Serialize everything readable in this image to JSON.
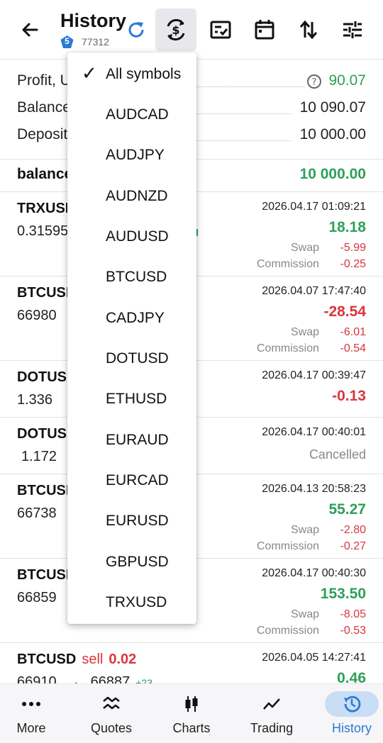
{
  "header": {
    "title": "History",
    "account_badge": "5",
    "account_number": "77312"
  },
  "summary": {
    "profit_label": "Profit, U",
    "profit_value": "90.07",
    "balance_label": "Balance",
    "balance_value": "10 090.07",
    "deposit_label": "Deposit",
    "deposit_value": "10 000.00",
    "balance_row_label": "balance",
    "balance_row_value": "10 000.00"
  },
  "trades": [
    {
      "symbol": "TRXUSI",
      "price": "0.31595",
      "date": "2026.04.17 01:09:21",
      "profit": "18.18",
      "swap_label": "Swap",
      "swap": "-5.99",
      "comm_label": "Commission",
      "comm": "-0.25"
    },
    {
      "symbol": "BTCUSI",
      "price": "66980",
      "date": "2026.04.07 17:47:40",
      "profit": "-28.54",
      "swap_label": "Swap",
      "swap": "-6.01",
      "comm_label": "Commission",
      "comm": "-0.54"
    },
    {
      "symbol": "DOTUSI",
      "price": "1.336",
      "date": "2026.04.17 00:39:47",
      "profit": "-0.13"
    },
    {
      "symbol": "DOTUSI",
      "price": "1.172",
      "date": "2026.04.17 00:40:01",
      "status": "Cancelled"
    },
    {
      "symbol": "BTCUSI",
      "price": "66738",
      "date": "2026.04.13 20:58:23",
      "profit": "55.27",
      "swap_label": "Swap",
      "swap": "-2.80",
      "comm_label": "Commission",
      "comm": "-0.27"
    },
    {
      "symbol": "BTCUSI",
      "price": "66859",
      "date": "2026.04.17 00:40:30",
      "profit": "153.50",
      "swap_label": "Swap",
      "swap": "-8.05",
      "comm_label": "Commission",
      "comm": "-0.53"
    },
    {
      "symbol": "BTCUSD",
      "side": "sell",
      "volume": "0.02",
      "open_price": "66910",
      "arrow": "→",
      "close_price": "66887",
      "points": "+23",
      "date": "2026.04.05 14:27:41",
      "profit": "0.46"
    }
  ],
  "dropdown": {
    "check": "✓",
    "items": [
      "All symbols",
      "AUDCAD",
      "AUDJPY",
      "AUDNZD",
      "AUDUSD",
      "BTCUSD",
      "CADJPY",
      "DOTUSD",
      "ETHUSD",
      "EURAUD",
      "EURCAD",
      "EURUSD",
      "GBPUSD",
      "TRXUSD"
    ]
  },
  "nav": {
    "items": [
      "More",
      "Quotes",
      "Charts",
      "Trading",
      "History"
    ]
  },
  "colors": {
    "green": "#2ea05a",
    "red": "#d9363e",
    "accent": "#2a7bd5"
  }
}
